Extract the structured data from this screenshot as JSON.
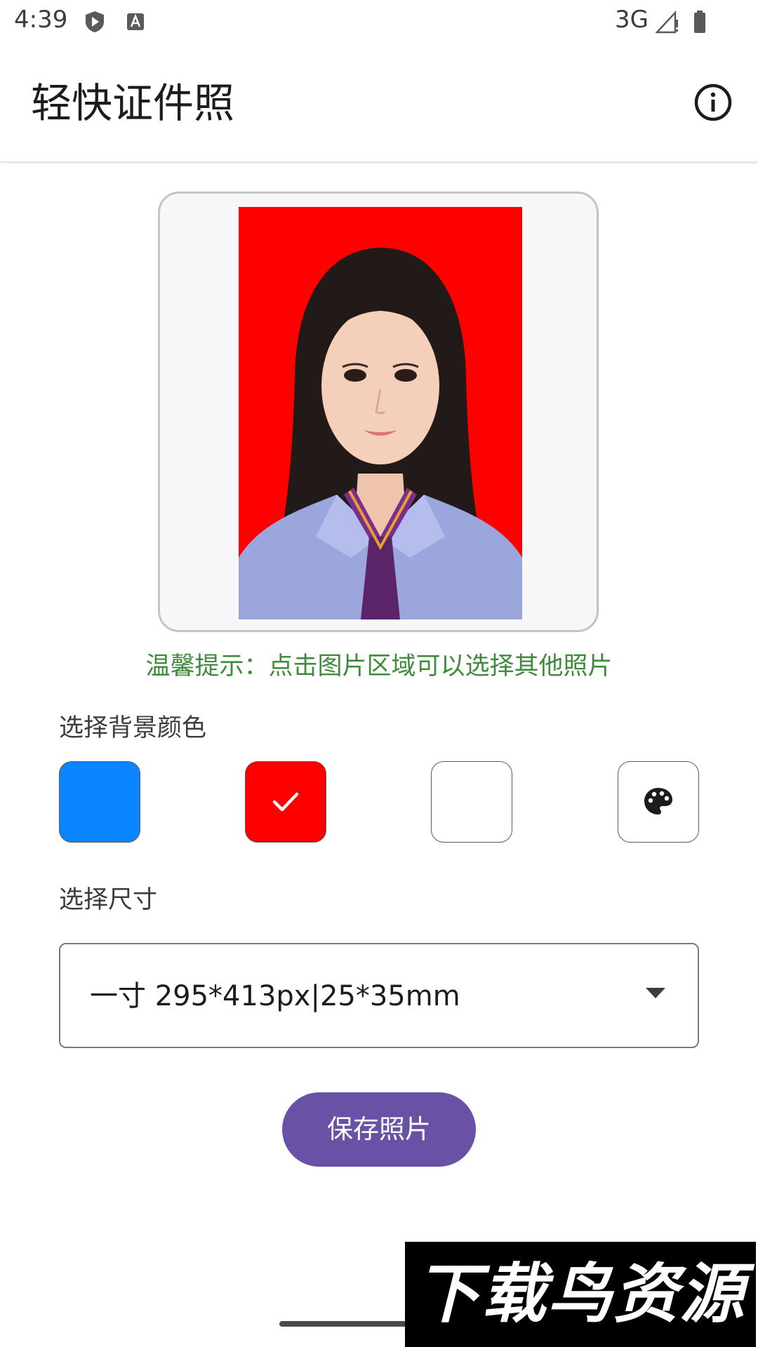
{
  "status_bar": {
    "time": "4:39",
    "network": "3G",
    "icons": [
      "shield-play-icon",
      "font-a-icon",
      "signal-icon",
      "battery-icon"
    ]
  },
  "app_bar": {
    "title": "轻快证件照",
    "info_icon": "info-icon"
  },
  "photo": {
    "background_color": "#ff0000"
  },
  "tip": "温馨提示：点击图片区域可以选择其他照片",
  "background_section": {
    "label": "选择背景颜色",
    "options": [
      {
        "name": "blue",
        "color": "#0a84ff",
        "selected": false
      },
      {
        "name": "red",
        "color": "#ff0000",
        "selected": true
      },
      {
        "name": "white",
        "color": "#ffffff",
        "selected": false
      },
      {
        "name": "custom",
        "icon": "palette-icon",
        "selected": false
      }
    ]
  },
  "size_section": {
    "label": "选择尺寸",
    "selected": "一寸 295*413px|25*35mm"
  },
  "save_button": {
    "label": "保存照片",
    "color": "#6951a5"
  },
  "watermark": "下载鸟资源"
}
